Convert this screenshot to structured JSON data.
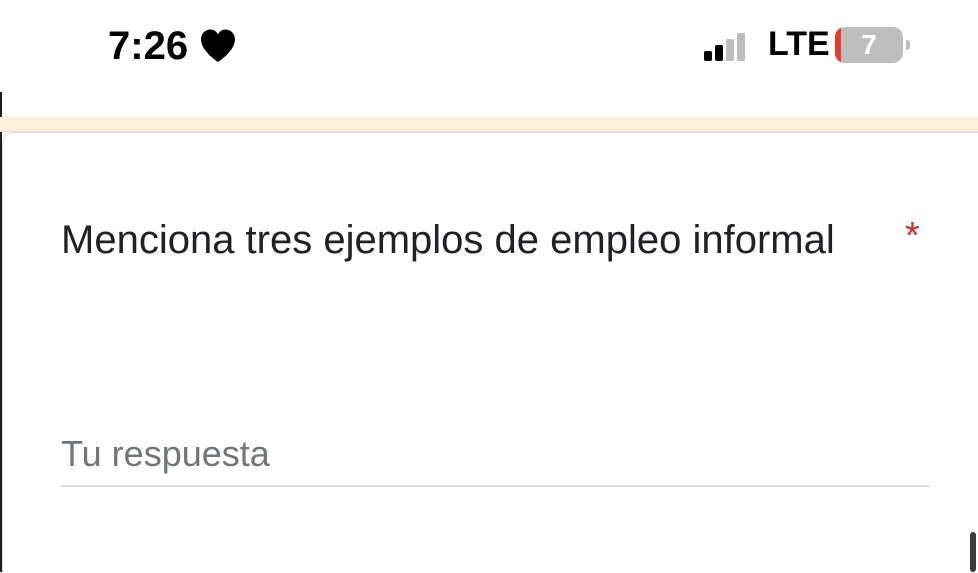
{
  "status_bar": {
    "time": "7:26",
    "focus_icon": "heart-icon",
    "signal_icon": "cellular-signal-icon",
    "signal_bars_active": 2,
    "signal_bars_total": 4,
    "network": "LTE",
    "battery_level": "7",
    "battery_fraction": 0.07,
    "battery_low_color": "#e63a2e"
  },
  "form": {
    "banner_color": "#faf0dc",
    "question": {
      "title": "Menciona tres ejemplos de empleo informal",
      "required_marker": "*",
      "required_color": "#d93025",
      "answer_placeholder": "Tu respuesta",
      "answer_value": ""
    }
  }
}
